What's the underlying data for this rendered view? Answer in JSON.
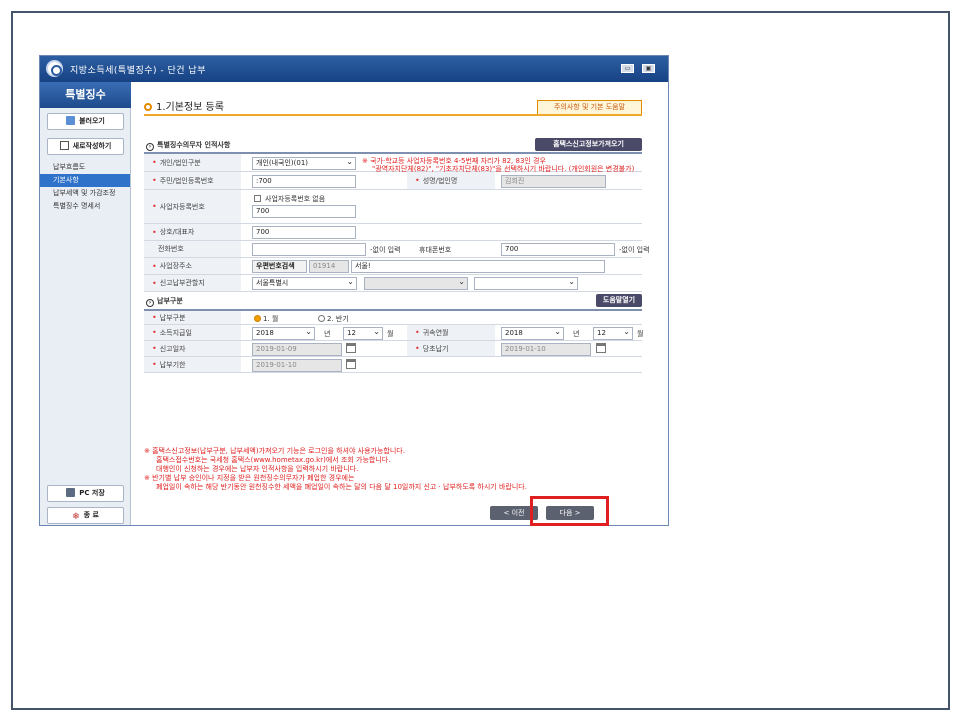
{
  "window": {
    "title": "지방소득세(특별징수) - 단건 납부"
  },
  "sidebar": {
    "header": "특별징수",
    "load_button": "불러오기",
    "new_button": "새로작성하기",
    "items": [
      {
        "label": "납부흐름도",
        "active": false
      },
      {
        "label": "기본사항",
        "active": true
      },
      {
        "label": "납부세액 및 가감조정",
        "active": false
      },
      {
        "label": "특별징수 명세서",
        "active": false
      }
    ],
    "pc_save_button": "PC 저장",
    "exit_button": "종 료"
  },
  "main": {
    "section_title": "1.기본정보 등록",
    "help_link": "주의사항 및 기본 도움말",
    "payer_section": {
      "title": "특별징수의무자 인적사항",
      "hometax_button": "홈택스신고정보가져오기",
      "type_label": "개인/법인구분",
      "type_value": "개인(내국인)(01)",
      "type_note_line1": "※ 국가·학교등 사업자등록번호 4-5번째 자리가 82, 83인 경우",
      "type_note_line2": "\"광역자치단체(82)\", \"기초자치단체(83)\"을 선택하시기 바랍니다. (개인회원은 변경불가)",
      "regno_label": "주민/법인등록번호",
      "regno_value": ":700",
      "name_label": "성명/법인명",
      "name_value": "김희진",
      "bizno_label": "사업자등록번호",
      "bizno_checkbox_label": "사업자등록번호 없음",
      "bizno_value": "700",
      "trade_label": "상호/대표자",
      "trade_value": "700",
      "phone_label": "전화번호",
      "phone_hint": "-없이 입력",
      "mobile_label": "휴대폰번호",
      "mobile_value": "700",
      "mobile_hint": "-없이 입력",
      "address_label": "사업장주소",
      "zip_button": "우편번호검색",
      "zip_value": "01914",
      "address_value": "서울!",
      "office_label": "신고납부관할지",
      "office_value1": "서울특별시",
      "office_value2": "",
      "office_value3": ""
    },
    "payment_section": {
      "title": "납부구분",
      "help_button": "도움말열기",
      "type_label": "납부구분",
      "option1": "1. 월",
      "option2": "2. 반기",
      "pay_month_label": "소득지급일",
      "pay_year": "2018",
      "year_unit": "년",
      "pay_month": "12",
      "month_unit": "월",
      "attr_label": "귀속연월",
      "attr_year": "2018",
      "attr_month": "12",
      "report_date_label": "신고일자",
      "report_date": "2019-01-09",
      "due_label": "당초납기",
      "due_date": "2019-01-10",
      "deadline_label": "납부기한",
      "deadline_date": "2019-01-10"
    },
    "notes": [
      "※ 홈택스신고정보(납부구분, 납부세액)가져오기 기능은 로그인을 하셔야 사용가능합니다.",
      "홈택스접수번호는 국세청 홈택스(www.hometax.go.kr)에서 조회 가능합니다.",
      "대행인이 신청하는 경우에는 납부자 인적사항을 입력하시기 바랍니다.",
      "※ 반기별 납부 승인이나 지정을 받은 원천징수의무자가 폐업한 경우에는",
      "폐업일이 속하는 해당 반기동안 원천징수한 세액을 폐업일이 속하는 달의 다음 달 10일까지 신고 · 납부하도록 하시기 바랍니다."
    ],
    "prev_button": "< 이전",
    "next_button": "다음 >"
  }
}
